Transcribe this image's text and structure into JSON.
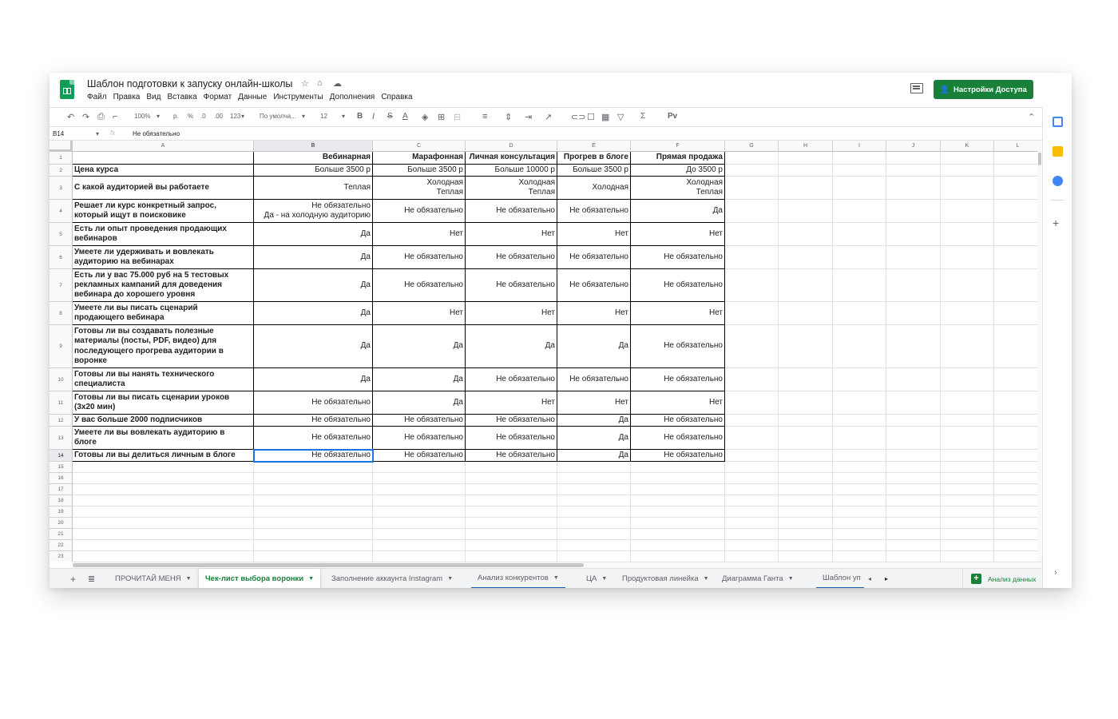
{
  "doc": {
    "title": "Шаблон подготовки к запуску онлайн-школы",
    "title_icons": [
      "star-icon",
      "move-to-drive-icon",
      "cloud-saved-icon"
    ]
  },
  "menu": [
    "Файл",
    "Правка",
    "Вид",
    "Вставка",
    "Формат",
    "Данные",
    "Инструменты",
    "Дополнения",
    "Справка"
  ],
  "share_label": "Настройки Доступа",
  "toolbar": {
    "zoom": "100%",
    "currency": "р.",
    "percent": "%",
    "dec_less": ".0",
    "dec_more": ".00",
    "format_more": "123",
    "font": "По умолча...",
    "size": "12",
    "bold": "B",
    "italic": "I",
    "strike": "S",
    "text_color": "A",
    "sum": "Σ",
    "input_tools": "Pv"
  },
  "formula_bar": {
    "cell_ref": "B14",
    "fx": "fx",
    "value": "Не обязательно"
  },
  "columns": [
    "A",
    "B",
    "C",
    "D",
    "E",
    "F",
    "G",
    "H",
    "I",
    "J",
    "K",
    "L"
  ],
  "rows": [
    "1",
    "2",
    "3",
    "4",
    "5",
    "6",
    "7",
    "8",
    "9",
    "10",
    "11",
    "12",
    "13",
    "14",
    "15",
    "16",
    "17",
    "18",
    "19",
    "20",
    "21",
    "22",
    "23"
  ],
  "table": {
    "header": [
      "",
      "Вебинарная",
      "Марафонная",
      "Личная консультация",
      "Прогрев в блоге",
      "Прямая продажа"
    ],
    "body": [
      [
        "Цена курса",
        "Больше 3500 р",
        "Больше 3500 р",
        "Больше 10000 р",
        "Больше 3500 р",
        "До 3500 р"
      ],
      [
        "С какой аудиторией вы работаете",
        "Теплая",
        "Холодная\nТеплая",
        "Холодная\nТеплая",
        "Холодная",
        "Холодная\nТеплая"
      ],
      [
        "Решает ли курс конкретный запрос,\nкоторый ищут в поисковике",
        "Не обязательно\nДа - на холодную аудиторию",
        "Не обязательно",
        "Не обязательно",
        "Не обязательно",
        "Да"
      ],
      [
        "Есть ли опыт проведения продающих\nвебинаров",
        "Да",
        "Нет",
        "Нет",
        "Нет",
        "Нет"
      ],
      [
        "Умеете ли удерживать и вовлекать\nаудиторию на вебинарах",
        "Да",
        "Не обязательно",
        "Не обязательно",
        "Не обязательно",
        "Не обязательно"
      ],
      [
        "Есть ли у вас 75.000 руб на 5 тестовых\nрекламных кампаний для доведения\nвебинара до хорошего уровня",
        "Да",
        "Не обязательно",
        "Не обязательно",
        "Не обязательно",
        "Не обязательно"
      ],
      [
        "Умеете ли вы писать сценарий\nпродающего вебинара",
        "Да",
        "Нет",
        "Нет",
        "Нет",
        "Нет"
      ],
      [
        "Готовы ли вы создавать полезные\nматериалы (посты, PDF, видео) для\nпоследующего прогрева аудитории в\nворонке",
        "Да",
        "Да",
        "Да",
        "Да",
        "Не обязательно"
      ],
      [
        "Готовы ли вы нанять технического\nспециалиста",
        "Да",
        "Да",
        "Не обязательно",
        "Не обязательно",
        "Не обязательно"
      ],
      [
        "Готовы ли вы писать сценарии уроков\n(3х20 мин)",
        "Не обязательно",
        "Да",
        "Нет",
        "Нет",
        "Нет"
      ],
      [
        "У вас больше 2000 подписчиков",
        "Не обязательно",
        "Не обязательно",
        "Не обязательно",
        "Да",
        "Не обязательно"
      ],
      [
        "Умеете ли вы вовлекать аудиторию в\nблоге",
        "Не обязательно",
        "Не обязательно",
        "Не обязательно",
        "Да",
        "Не обязательно"
      ],
      [
        "Готовы ли вы делиться личным в блоге",
        "Не обязательно",
        "Не обязательно",
        "Не обязательно",
        "Да",
        "Не обязательно"
      ]
    ]
  },
  "tabs": [
    {
      "label": "ПРОЧИТАЙ МЕНЯ"
    },
    {
      "label": "Чек-лист выбора воронки"
    },
    {
      "label": "Заполнение аккаунта Instagram"
    },
    {
      "label": "Анализ конкурентов"
    },
    {
      "label": "ЦА"
    },
    {
      "label": "Продуктовая линейка"
    },
    {
      "label": "Диаграмма Ганта"
    },
    {
      "label": "Шаблон уп"
    }
  ],
  "explore_label": "Анализ данных",
  "colors": {
    "brand": "#188038",
    "selection": "#1a73e8"
  }
}
